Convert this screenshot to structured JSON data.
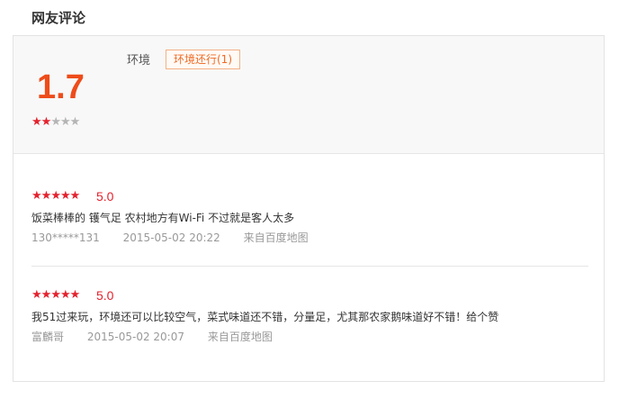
{
  "section_title": "网友评论",
  "summary": {
    "score": "1.7",
    "stars": {
      "filled": 2,
      "total": 5
    },
    "tag_label": "环境",
    "tag_badge": "环境还行(1)"
  },
  "reviews": [
    {
      "rating_value": 5,
      "score": "5.0",
      "text": "饭菜棒棒的 镬气足 农村地方有Wi-Fi 不过就是客人太多",
      "user": "130*****131",
      "date": "2015-05-02 20:22",
      "source": "来自百度地图"
    },
    {
      "rating_value": 5,
      "score": "5.0",
      "text": "我51过来玩，环境还可以比较空气，菜式味道还不错，分量足，尤其那农家鹅味道好不错！给个赞",
      "user": "富麟哥",
      "date": "2015-05-02 20:07",
      "source": "来自百度地图"
    }
  ],
  "colors": {
    "accent": "#ee4c1a",
    "star": "#e4222e",
    "star_off": "#b5b5b5",
    "badge": "#f06a24"
  },
  "icons": {
    "star": "star-icon"
  }
}
